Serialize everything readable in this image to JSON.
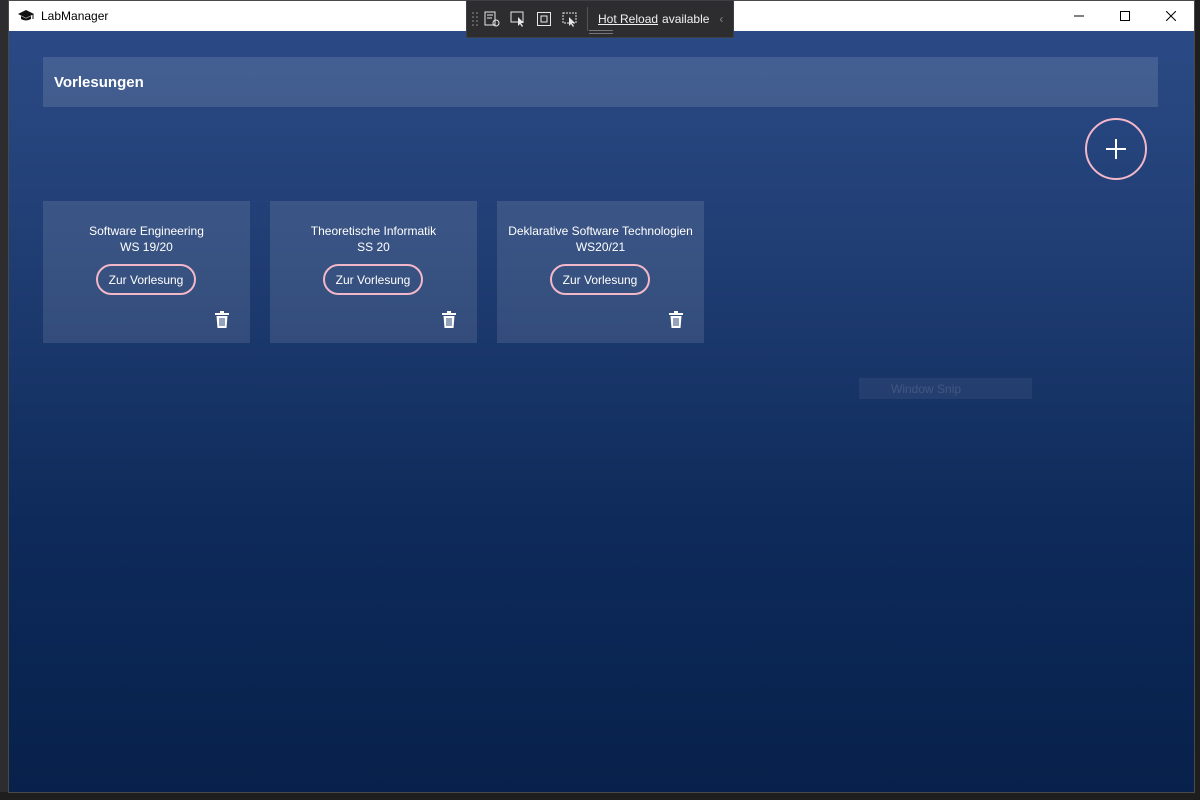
{
  "window": {
    "title": "LabManager"
  },
  "hot_reload": {
    "link": "Hot Reload",
    "status": "available"
  },
  "header": {
    "title": "Vorlesungen"
  },
  "overlay": {
    "window_snip": "Window Snip"
  },
  "courses": [
    {
      "name": "Software Engineering",
      "term": "WS 19/20",
      "button": "Zur Vorlesung"
    },
    {
      "name": "Theoretische Informatik",
      "term": "SS 20",
      "button": "Zur Vorlesung"
    },
    {
      "name": "Deklarative Software Technologien",
      "term": "WS20/21",
      "button": "Zur Vorlesung"
    }
  ],
  "colors": {
    "accent_outline": "#f2b7c8",
    "background_top": "#2b4a85",
    "background_bottom": "#07214b"
  }
}
